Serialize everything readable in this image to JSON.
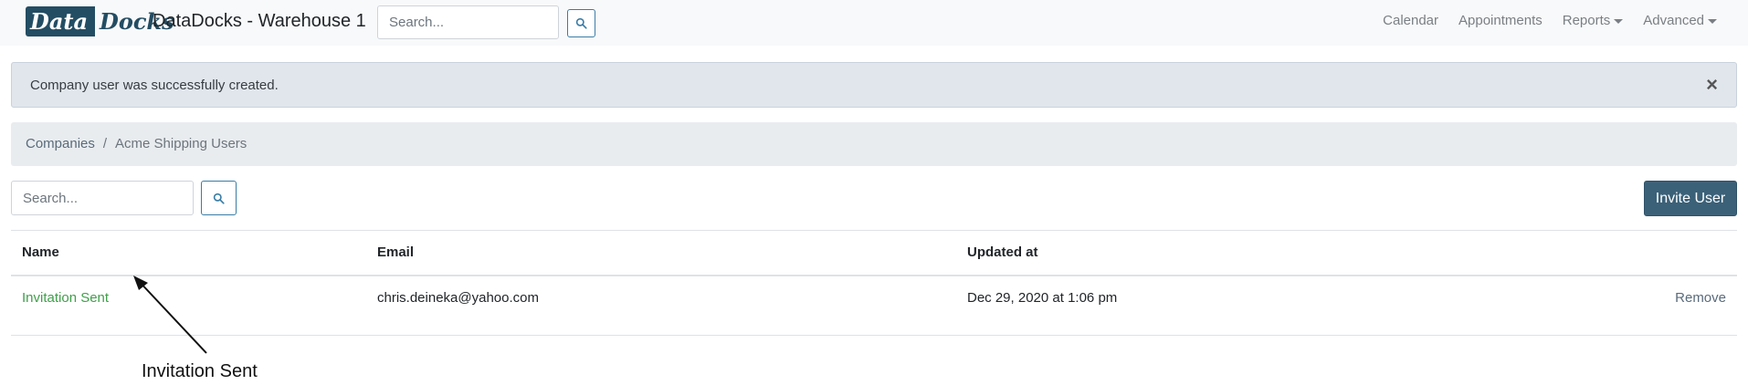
{
  "navbar": {
    "logo_part1": "Data",
    "logo_part2": "Docks",
    "title": "DataDocks - Warehouse 1",
    "search_placeholder": "Search...",
    "search_icon": "search-icon",
    "links": {
      "calendar": "Calendar",
      "appointments": "Appointments",
      "reports": "Reports",
      "advanced": "Advanced"
    }
  },
  "alert": {
    "message": "Company user was successfully created.",
    "close": "×"
  },
  "breadcrumb": {
    "companies": "Companies",
    "separator": "/",
    "current": "Acme Shipping Users"
  },
  "toolbar": {
    "search_placeholder": "Search...",
    "search_icon": "search-icon",
    "invite_label": "Invite User"
  },
  "table": {
    "headers": {
      "name": "Name",
      "email": "Email",
      "updated": "Updated at"
    },
    "rows": [
      {
        "name": "Invitation Sent",
        "email": "chris.deineka@yahoo.com",
        "updated": "Dec 29, 2020 at 1:06 pm",
        "action": "Remove"
      }
    ]
  },
  "annotation": {
    "label": "Invitation Sent"
  },
  "colors": {
    "brand": "#234d63",
    "link_green": "#3fa04a",
    "button_primary": "#3b6178",
    "alert_bg": "#e1e6ec"
  }
}
